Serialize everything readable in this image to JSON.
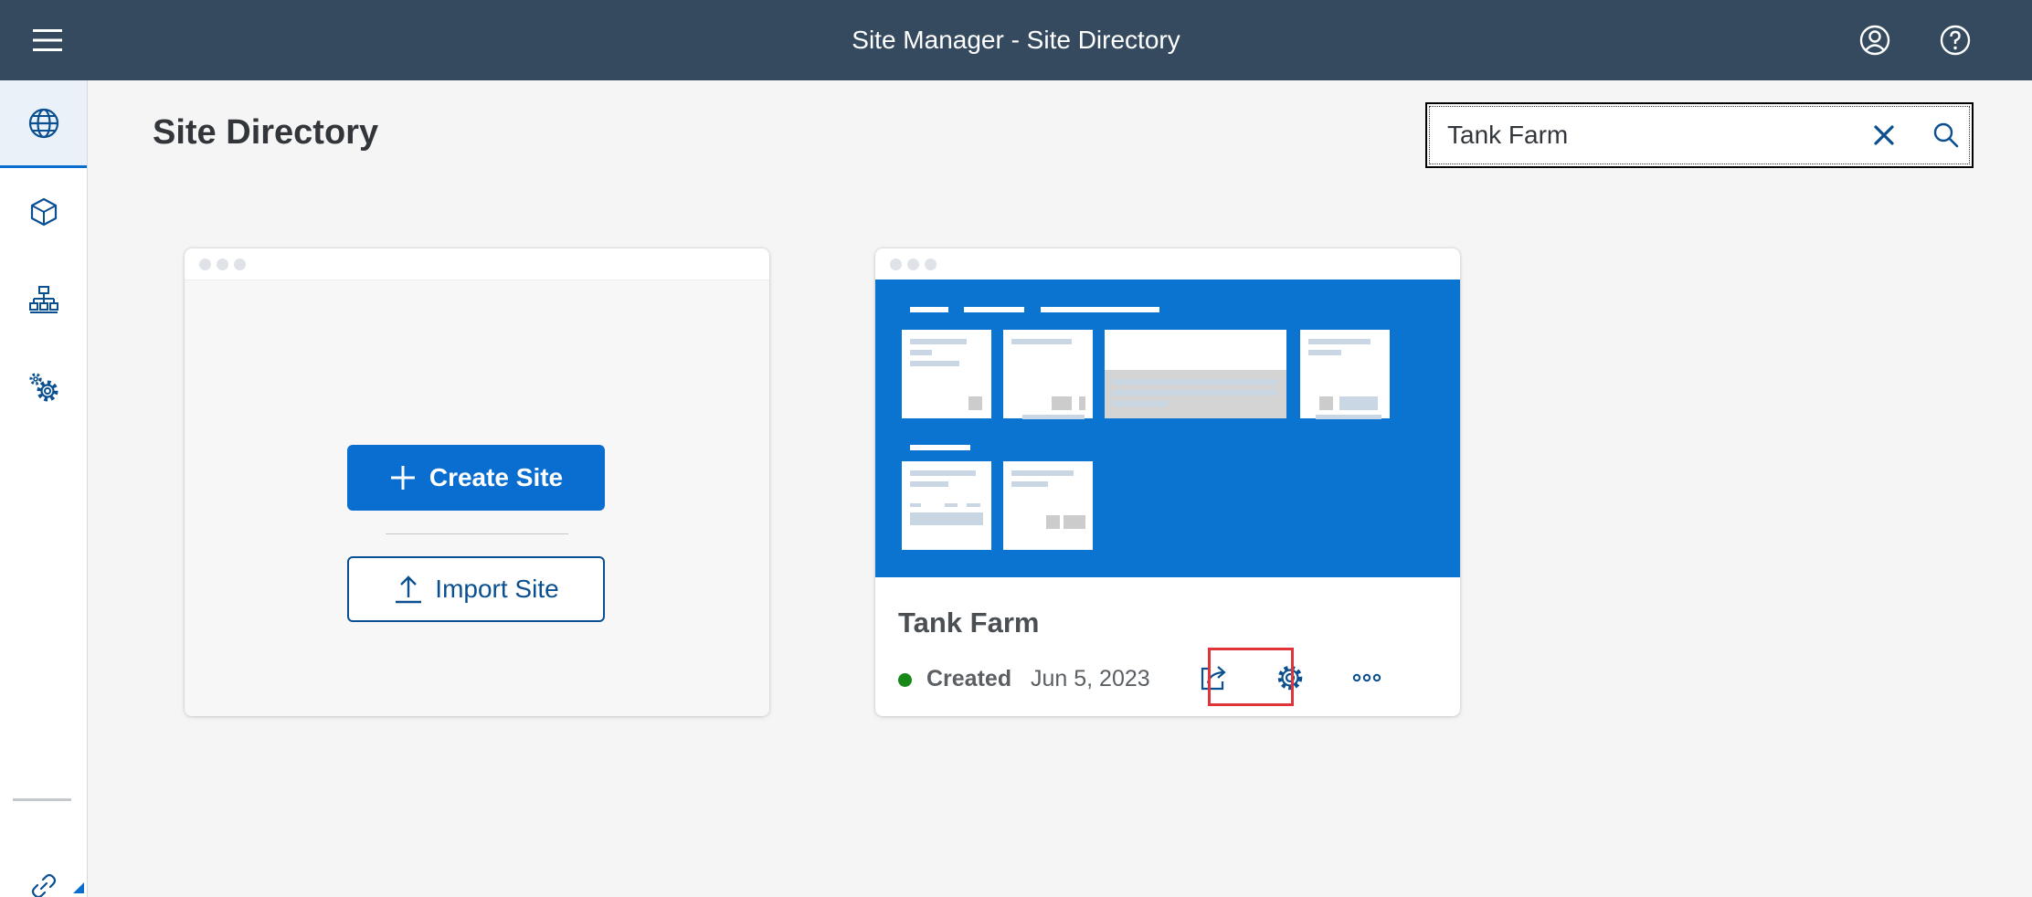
{
  "shell": {
    "title": "Site Manager - Site Directory",
    "menu_icon": "hamburger-menu-icon",
    "profile_icon": "user-profile-icon",
    "help_icon": "help-icon"
  },
  "sidenav": {
    "items": [
      {
        "name": "site-directory",
        "icon": "globe-icon",
        "selected": true
      },
      {
        "name": "content-manager",
        "icon": "cube-icon",
        "selected": false
      },
      {
        "name": "channel-manager",
        "icon": "hierarchy-icon",
        "selected": false
      },
      {
        "name": "settings",
        "icon": "gears-icon",
        "selected": false
      }
    ],
    "footer_icon": "link-icon"
  },
  "page": {
    "title": "Site Directory"
  },
  "search": {
    "value": "Tank Farm",
    "clear_icon": "clear-icon",
    "search_icon": "search-icon"
  },
  "new_site_card": {
    "create_label": "Create Site",
    "import_label": "Import Site"
  },
  "site_card": {
    "name": "Tank Farm",
    "status": "Created",
    "date": "Jun 5, 2023",
    "actions": [
      "open-external-icon",
      "settings-icon",
      "more-icon"
    ]
  },
  "colors": {
    "shell_bar": "#354a5f",
    "accent": "#0a6ed1",
    "status_success": "#188918",
    "highlight": "#e0343b"
  }
}
